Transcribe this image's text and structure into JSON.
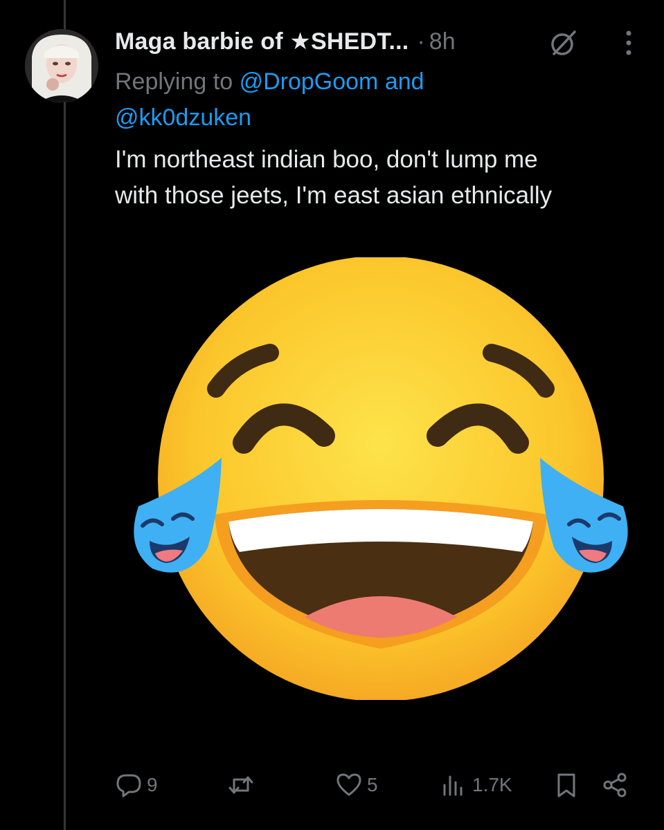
{
  "post": {
    "author": {
      "display_name": "Maga barbie of ★SHEDT...",
      "avatar_icon": "profile-photo"
    },
    "separator": "·",
    "timestamp": "8h",
    "reply": {
      "prefix": "Replying to",
      "mention_1": "@DropGoom",
      "conjunction": "and",
      "mention_2": "@kk0dzuken"
    },
    "text_line_1": "I'm northeast indian boo, don't lump me",
    "text_line_2": "with those jeets, I'm east asian ethnically",
    "media": {
      "icon": "face-with-tears-of-joy-emoji"
    }
  },
  "actions": {
    "reply": {
      "icon": "reply-bubble-icon",
      "count": "9"
    },
    "repost": {
      "icon": "repost-icon",
      "count": ""
    },
    "like": {
      "icon": "heart-icon",
      "count": "5"
    },
    "views": {
      "icon": "views-bar-chart-icon",
      "count": "1.7K"
    },
    "bookmark": {
      "icon": "bookmark-icon"
    },
    "share": {
      "icon": "share-icon"
    }
  },
  "colors": {
    "background": "#000000",
    "text": "#e7e9ea",
    "muted": "#71767b",
    "accent": "#1d9bf0",
    "thread_line": "#333639"
  }
}
